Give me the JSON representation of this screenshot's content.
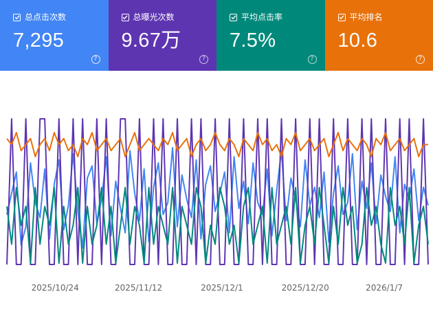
{
  "cards": [
    {
      "label": "总点击次数",
      "value": "7,295",
      "color": "#4285f4",
      "icon": "checkbox-checked-icon"
    },
    {
      "label": "总曝光次数",
      "value": "9.67万",
      "color": "#5e35b1",
      "icon": "checkbox-checked-icon"
    },
    {
      "label": "平均点击率",
      "value": "7.5%",
      "color": "#00897b",
      "icon": "checkbox-checked-icon"
    },
    {
      "label": "平均排名",
      "value": "10.6",
      "color": "#e8710a",
      "icon": "checkbox-checked-icon"
    }
  ],
  "help_icon": "?",
  "chart_data": {
    "type": "line",
    "x_start": "2025-10-13",
    "x_end": "2026-01-17",
    "x_tick_labels": [
      "2025/10/24",
      "2025/11/12",
      "2025/12/1",
      "2025/12/20",
      "2026/1/7"
    ],
    "x_tick_dates": [
      "2025-10-24",
      "2025-11-12",
      "2025-12-01",
      "2025-12-20",
      "2026-01-07"
    ],
    "grid": false,
    "legend": "none",
    "series": [
      {
        "color": "#4285f4",
        "values": [
          62,
          55,
          48,
          72,
          66,
          45,
          58,
          63,
          47,
          70,
          52,
          44,
          67,
          59,
          42,
          61,
          73,
          50,
          46,
          65,
          57,
          43,
          69,
          51,
          60,
          68,
          41,
          55,
          64,
          47,
          71,
          53,
          45,
          62,
          58,
          40,
          66,
          49,
          57,
          63,
          44,
          70,
          52,
          46,
          61,
          55,
          48,
          68,
          43,
          60,
          51,
          65,
          45,
          58,
          62,
          47,
          69,
          54,
          41,
          64,
          50,
          57,
          66,
          44,
          59,
          53,
          63,
          48,
          71,
          55,
          46,
          62,
          58,
          42,
          67,
          51,
          60,
          45,
          65,
          49,
          56,
          61,
          43,
          68,
          52,
          57,
          47,
          64,
          53,
          59
        ]
      },
      {
        "color": "#5e35b1",
        "values": [
          18,
          19,
          18,
          18,
          19,
          18,
          18,
          19,
          19,
          18,
          18,
          19,
          18,
          18,
          19,
          18,
          19,
          18,
          18,
          19,
          18,
          19,
          18,
          18,
          19,
          19,
          18,
          18,
          19,
          18,
          18,
          19,
          18,
          19,
          18,
          18,
          19,
          18,
          18,
          19,
          18,
          19,
          18,
          18,
          19,
          18,
          18,
          19,
          18,
          18,
          19,
          18,
          18,
          19,
          18,
          19,
          18,
          18,
          19,
          18,
          18,
          19,
          18,
          18,
          19,
          18,
          19,
          18,
          18,
          19,
          18,
          18,
          19,
          18,
          18,
          19,
          18,
          19,
          18,
          18,
          19,
          18,
          18,
          19,
          18,
          19,
          18,
          18,
          19,
          18
        ]
      },
      {
        "color": "#00897b",
        "values": [
          7.8,
          7.6,
          7.9,
          7.7,
          7.8,
          7.5,
          7.9,
          7.6,
          7.8,
          7.7,
          7.9,
          7.5,
          7.8,
          7.6,
          7.7,
          7.9,
          7.5,
          7.8,
          7.6,
          7.7,
          7.9,
          7.6,
          7.8,
          7.5,
          7.7,
          7.9,
          7.6,
          7.8,
          7.7,
          7.5,
          7.9,
          7.6,
          7.8,
          7.7,
          7.6,
          7.9,
          7.5,
          7.8,
          7.7,
          7.6,
          7.9,
          7.8,
          7.5,
          7.7,
          7.6,
          7.9,
          7.8,
          7.6,
          7.7,
          7.5,
          7.8,
          7.9,
          7.6,
          7.7,
          7.8,
          7.5,
          7.9,
          7.6,
          7.7,
          7.8,
          7.6,
          7.9,
          7.5,
          7.7,
          7.8,
          7.6,
          7.9,
          7.7,
          7.5,
          7.8,
          7.6,
          7.9,
          7.7,
          7.8,
          7.5,
          7.6,
          7.9,
          7.7,
          7.8,
          7.6,
          7.5,
          7.9,
          7.7,
          7.8,
          7.6,
          7.9,
          7.5,
          7.7,
          7.8,
          7.6
        ]
      },
      {
        "color": "#e8710a",
        "values": [
          10.5,
          10.6,
          10.4,
          10.7,
          10.6,
          10.5,
          10.8,
          10.6,
          10.5,
          10.7,
          10.4,
          10.6,
          10.5,
          10.7,
          10.6,
          10.8,
          10.5,
          10.6,
          10.4,
          10.7,
          10.6,
          10.5,
          10.7,
          10.6,
          10.5,
          10.8,
          10.6,
          10.4,
          10.7,
          10.6,
          10.5,
          10.6,
          10.7,
          10.5,
          10.6,
          10.4,
          10.7,
          10.6,
          10.5,
          10.8,
          10.6,
          10.5,
          10.7,
          10.6,
          10.4,
          10.6,
          10.7,
          10.5,
          10.6,
          10.8,
          10.5,
          10.6,
          10.7,
          10.4,
          10.6,
          10.5,
          10.7,
          10.6,
          10.8,
          10.5,
          10.6,
          10.4,
          10.7,
          10.6,
          10.5,
          10.7,
          10.6,
          10.5,
          10.8,
          10.6,
          10.4,
          10.7,
          10.5,
          10.6,
          10.7,
          10.5,
          10.6,
          10.8,
          10.5,
          10.6,
          10.4,
          10.7,
          10.6,
          10.5,
          10.7,
          10.6,
          10.5,
          10.8,
          10.6,
          10.6
        ]
      }
    ]
  }
}
